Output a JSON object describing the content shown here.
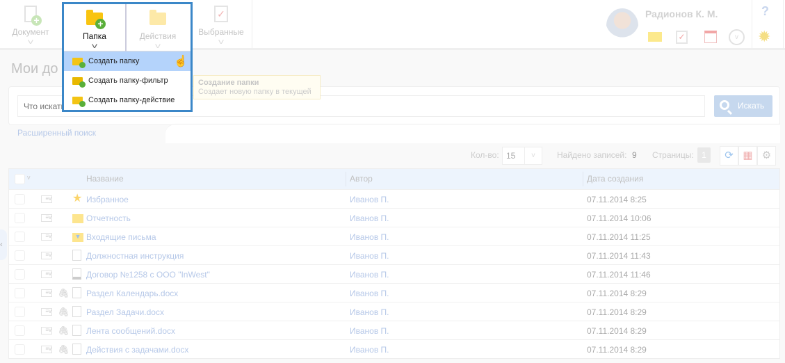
{
  "toolbar": {
    "document": "Документ",
    "folder": "Папка",
    "actions": "Действия",
    "favorites": "Выбранные"
  },
  "dropdown": {
    "items": [
      "Создать папку",
      "Создать папку-фильтр",
      "Создать папку-действие"
    ]
  },
  "tooltip": {
    "title": "Создание папки",
    "text": "Создает новую папку в текущей"
  },
  "user": {
    "name": "Радионов К. М.",
    "help": "?"
  },
  "page": {
    "title": "Мои до"
  },
  "search": {
    "placeholder": "Что искать",
    "button": "Искать",
    "advanced": "Расширенный поиск"
  },
  "controls": {
    "qty_label": "Кол-во:",
    "qty_value": "15",
    "found_label": "Найдено записей:",
    "found_value": "9",
    "pages_label": "Страницы:",
    "page": "1"
  },
  "table": {
    "columns": [
      "Название",
      "Автор",
      "Дата создания"
    ],
    "rows": [
      {
        "name": "Избранное",
        "author": "Иванов П.",
        "date": "07.11.2014 8:25",
        "icon": "star",
        "clip": false
      },
      {
        "name": "Отчетность",
        "author": "Иванов П.",
        "date": "07.11.2014 10:06",
        "icon": "folder",
        "clip": false
      },
      {
        "name": "Входящие письма",
        "author": "Иванов П.",
        "date": "07.11.2014 11:25",
        "icon": "filter-folder",
        "clip": false
      },
      {
        "name": "Должностная инструкция",
        "author": "Иванов П.",
        "date": "07.11.2014 11:43",
        "icon": "document",
        "clip": false
      },
      {
        "name": "Договор №1258 с ООО \"InWest\"",
        "author": "Иванов П.",
        "date": "07.11.2014 11:46",
        "icon": "linked-document",
        "clip": false
      },
      {
        "name": "Раздел Календарь.docx",
        "author": "Иванов П.",
        "date": "07.11.2014 8:29",
        "icon": "file",
        "clip": true
      },
      {
        "name": "Раздел Задачи.docx",
        "author": "Иванов П.",
        "date": "07.11.2014 8:29",
        "icon": "file",
        "clip": true
      },
      {
        "name": "Лента сообщений.docx",
        "author": "Иванов П.",
        "date": "07.11.2014 8:29",
        "icon": "file",
        "clip": true
      },
      {
        "name": "Действия с задачами.docx",
        "author": "Иванов П.",
        "date": "07.11.2014 8:29",
        "icon": "file",
        "clip": true
      }
    ]
  }
}
